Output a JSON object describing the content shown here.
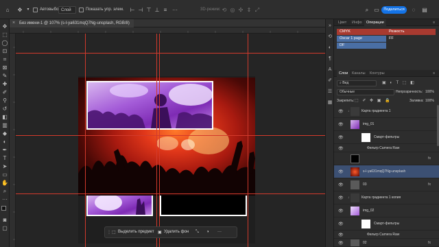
{
  "options_bar": {
    "autoselect_label": "Автовыбор:",
    "autoselect_value": "Слой",
    "transform_label": "Показать упр. элем.",
    "mode_3d_label": "3D-режим:",
    "share_label": "Поделиться"
  },
  "document": {
    "tab_title": "Без имени-1 @ 107% (s-l-ya631mqQ7Ng-unsplash, RGB/8)"
  },
  "contextual_bar": {
    "select_subject_label": "Выделить предмет",
    "remove_bg_label": "Удалить фон"
  },
  "actions_panel": {
    "tabs": [
      "Цвет",
      "Инфо",
      "Операции"
    ],
    "active_tab": "Операции",
    "rows": [
      {
        "left": "CMYK",
        "right": "Резкость",
        "left_color": "#a83a30",
        "right_color": "#a83a30"
      },
      {
        "left": "Oscar 1 page",
        "right": "FF",
        "left_color": "#4a6fa5",
        "right_color": "#2d2d2d"
      },
      {
        "left": "DF",
        "right": "",
        "left_color": "#4a6fa5",
        "right_color": "#2d2d2d"
      }
    ]
  },
  "layers_panel": {
    "tabs": [
      "Слои",
      "Каналы",
      "Контуры"
    ],
    "active_tab": "Слои",
    "filter_kind": "Вид",
    "blend_mode": "Обычные",
    "opacity_label": "Непрозрачность:",
    "opacity_value": "100%",
    "lock_label": "Закрепить:",
    "fill_label": "Заливка:",
    "fill_value": "100%",
    "layers": [
      {
        "name": "Карта градиента 1",
        "type": "adjustment",
        "fx": "",
        "selected": false
      },
      {
        "name": "img_01",
        "type": "smart",
        "fx": "",
        "selected": false
      },
      {
        "name": "Смарт-фильтры",
        "type": "filter-mask",
        "fx": "",
        "selected": false
      },
      {
        "name": "Фильтр Camera Raw",
        "type": "filter",
        "fx": "",
        "selected": false
      },
      {
        "name": "",
        "type": "black",
        "fx": "fx",
        "selected": false
      },
      {
        "name": "s-l-ya631mqQ7Ng-unsplash",
        "type": "photo",
        "fx": "",
        "selected": true
      },
      {
        "name": "03",
        "type": "gray",
        "fx": "fx",
        "selected": false
      },
      {
        "name": "Карта градиента 1 копия",
        "type": "adjustment",
        "fx": "",
        "selected": false
      },
      {
        "name": "img_02",
        "type": "smart",
        "fx": "",
        "selected": false
      },
      {
        "name": "Смарт-фильтры",
        "type": "filter-mask",
        "fx": "",
        "selected": false
      },
      {
        "name": "Фильтр Camera Raw",
        "type": "filter",
        "fx": "",
        "selected": false
      },
      {
        "name": "02",
        "type": "gray",
        "fx": "fx",
        "selected": false
      }
    ]
  },
  "colors": {
    "accent": "#1473e6",
    "guide": "#d33a2c",
    "selected_layer": "#3c5073",
    "action_red": "#a83a30",
    "action_blue": "#4a6fa5"
  }
}
